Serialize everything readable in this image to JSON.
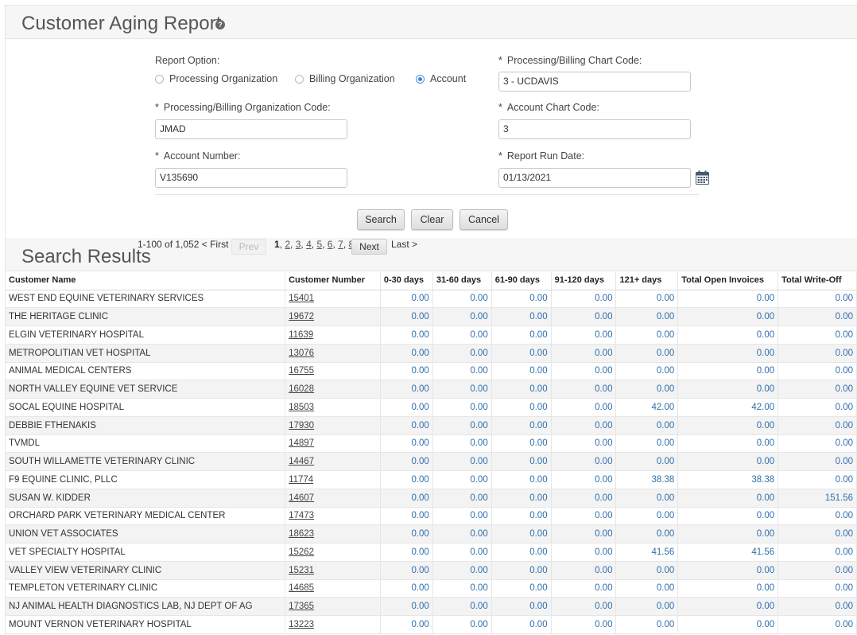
{
  "page": {
    "title": "Customer Aging Report",
    "help_icon": "?"
  },
  "form": {
    "report_option_label": "Report Option:",
    "report_options": [
      "Processing Organization",
      "Billing Organization",
      "Account"
    ],
    "selected_option": "Account",
    "chart_code_label": "Processing/Billing Chart Code:",
    "chart_code_value": "3 - UCDAVIS",
    "org_code_label": "Processing/Billing Organization Code:",
    "org_code_value": "JMAD",
    "account_chart_label": "Account Chart Code:",
    "account_chart_value": "3",
    "account_number_label": "Account Number:",
    "account_number_value": "V135690",
    "run_date_label": "Report Run Date:",
    "run_date_value": "01/13/2021",
    "required_mark": "*"
  },
  "buttons": {
    "search": "Search",
    "clear": "Clear",
    "cancel": "Cancel"
  },
  "results": {
    "title": "Search Results",
    "range": "1-100 of 1,052",
    "first": "< First",
    "prev": "Prev",
    "pages": [
      "1",
      "2",
      "3",
      "4",
      "5",
      "6",
      "7",
      "8"
    ],
    "current_page": "1",
    "next": "Next",
    "last": "Last >",
    "columns": [
      "Customer Name",
      "Customer Number",
      "0-30 days",
      "31-60 days",
      "61-90 days",
      "91-120 days",
      "121+ days",
      "Total Open Invoices",
      "Total Write-Off"
    ],
    "rows": [
      [
        "WEST END EQUINE VETERINARY SERVICES",
        "15401",
        "0.00",
        "0.00",
        "0.00",
        "0.00",
        "0.00",
        "0.00",
        "0.00"
      ],
      [
        "THE HERITAGE CLINIC",
        "19672",
        "0.00",
        "0.00",
        "0.00",
        "0.00",
        "0.00",
        "0.00",
        "0.00"
      ],
      [
        "ELGIN VETERINARY HOSPITAL",
        "11639",
        "0.00",
        "0.00",
        "0.00",
        "0.00",
        "0.00",
        "0.00",
        "0.00"
      ],
      [
        "METROPOLITIAN VET HOSPITAL",
        "13076",
        "0.00",
        "0.00",
        "0.00",
        "0.00",
        "0.00",
        "0.00",
        "0.00"
      ],
      [
        "ANIMAL MEDICAL CENTERS",
        "16755",
        "0.00",
        "0.00",
        "0.00",
        "0.00",
        "0.00",
        "0.00",
        "0.00"
      ],
      [
        "NORTH VALLEY EQUINE VET SERVICE",
        "16028",
        "0.00",
        "0.00",
        "0.00",
        "0.00",
        "0.00",
        "0.00",
        "0.00"
      ],
      [
        "SOCAL EQUINE HOSPITAL",
        "18503",
        "0.00",
        "0.00",
        "0.00",
        "0.00",
        "42.00",
        "42.00",
        "0.00"
      ],
      [
        "DEBBIE FTHENAKIS",
        "17930",
        "0.00",
        "0.00",
        "0.00",
        "0.00",
        "0.00",
        "0.00",
        "0.00"
      ],
      [
        "TVMDL",
        "14897",
        "0.00",
        "0.00",
        "0.00",
        "0.00",
        "0.00",
        "0.00",
        "0.00"
      ],
      [
        "SOUTH WILLAMETTE VETERINARY CLINIC",
        "14467",
        "0.00",
        "0.00",
        "0.00",
        "0.00",
        "0.00",
        "0.00",
        "0.00"
      ],
      [
        "F9 EQUINE CLINIC, PLLC",
        "11774",
        "0.00",
        "0.00",
        "0.00",
        "0.00",
        "38.38",
        "38.38",
        "0.00"
      ],
      [
        "SUSAN W. KIDDER",
        "14607",
        "0.00",
        "0.00",
        "0.00",
        "0.00",
        "0.00",
        "0.00",
        "151.56"
      ],
      [
        "ORCHARD PARK VETERINARY MEDICAL CENTER",
        "17473",
        "0.00",
        "0.00",
        "0.00",
        "0.00",
        "0.00",
        "0.00",
        "0.00"
      ],
      [
        "UNION VET ASSOCIATES",
        "18623",
        "0.00",
        "0.00",
        "0.00",
        "0.00",
        "0.00",
        "0.00",
        "0.00"
      ],
      [
        "VET SPECIALTY HOSPITAL",
        "15262",
        "0.00",
        "0.00",
        "0.00",
        "0.00",
        "41.56",
        "41.56",
        "0.00"
      ],
      [
        "VALLEY VIEW VETERINARY CLINIC",
        "15231",
        "0.00",
        "0.00",
        "0.00",
        "0.00",
        "0.00",
        "0.00",
        "0.00"
      ],
      [
        "TEMPLETON VETERINARY CLINIC",
        "14685",
        "0.00",
        "0.00",
        "0.00",
        "0.00",
        "0.00",
        "0.00",
        "0.00"
      ],
      [
        "NJ ANIMAL HEALTH DIAGNOSTICS LAB, NJ DEPT OF AG",
        "17365",
        "0.00",
        "0.00",
        "0.00",
        "0.00",
        "0.00",
        "0.00",
        "0.00"
      ],
      [
        "MOUNT VERNON VETERINARY HOSPITAL",
        "13223",
        "0.00",
        "0.00",
        "0.00",
        "0.00",
        "0.00",
        "0.00",
        "0.00"
      ]
    ]
  },
  "colors": {
    "amount": "#2f6fad",
    "accent_radio": "#3b82d6"
  },
  "icons": {
    "help": "help-icon",
    "calendar": "calendar-icon"
  }
}
